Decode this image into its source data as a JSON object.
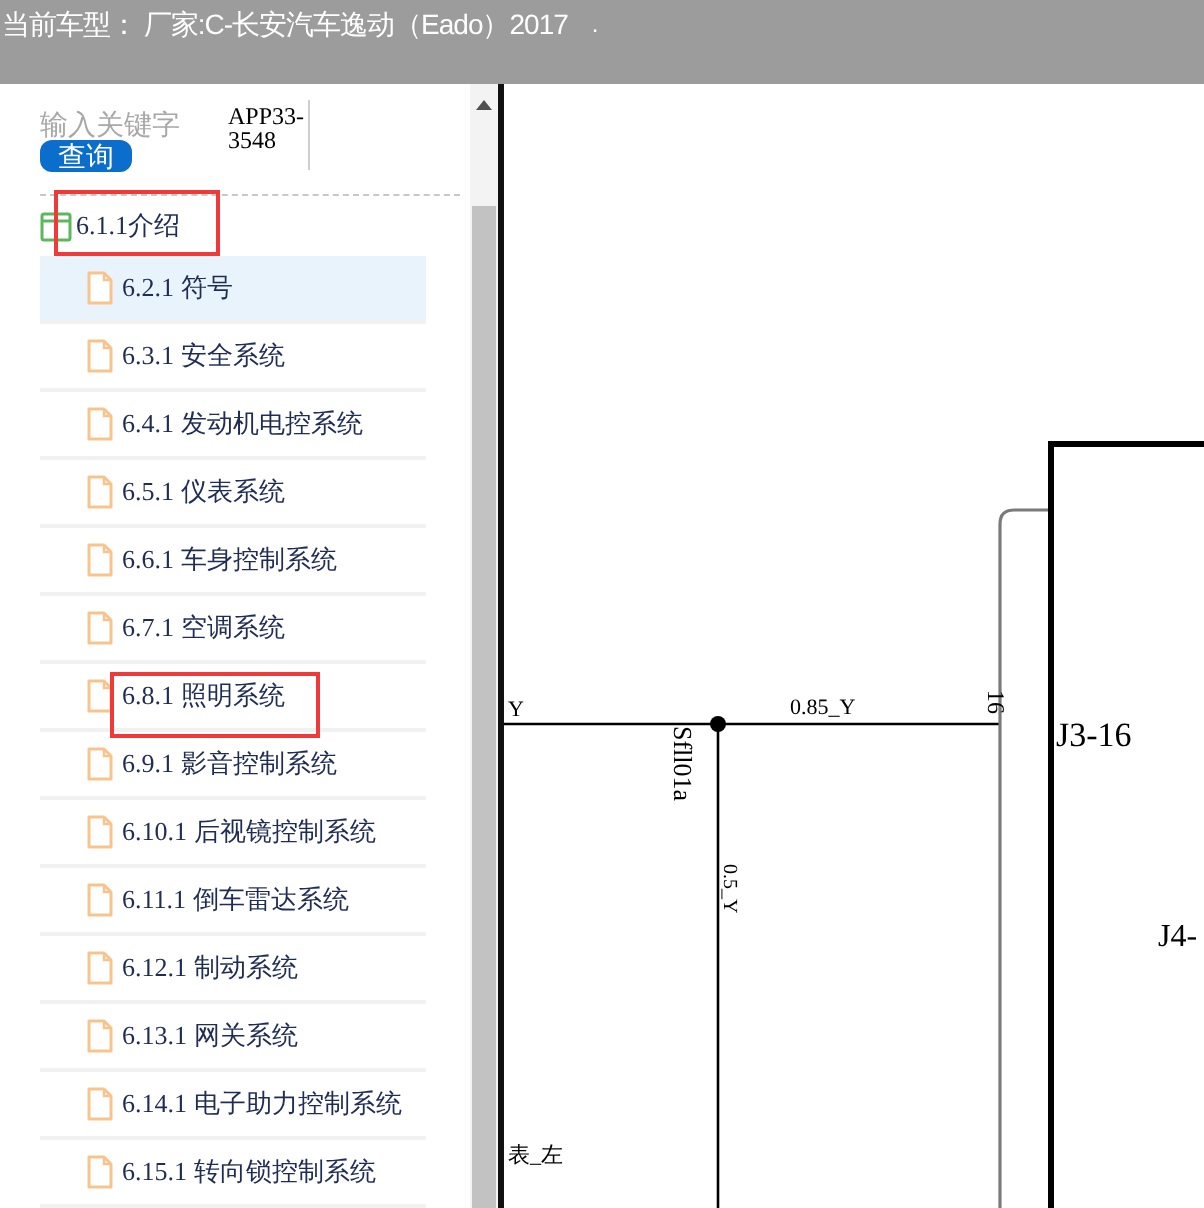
{
  "header": {
    "title": "当前车型： 厂家:C-长安汽车逸动（Eado）2017",
    "suffix": "."
  },
  "search": {
    "placeholder": "输入关键字",
    "button": "查询",
    "code": "APP33-3548"
  },
  "tree": {
    "label": "6.1.1介绍",
    "highlighted": true,
    "children": [
      {
        "label": "6.2.1 符号",
        "selected": true,
        "highlighted": false
      },
      {
        "label": "6.3.1 安全系统",
        "selected": false,
        "highlighted": false
      },
      {
        "label": "6.4.1 发动机电控系统",
        "selected": false,
        "highlighted": false
      },
      {
        "label": "6.5.1 仪表系统",
        "selected": false,
        "highlighted": false
      },
      {
        "label": "6.6.1 车身控制系统",
        "selected": false,
        "highlighted": false
      },
      {
        "label": "6.7.1 空调系统",
        "selected": false,
        "highlighted": false
      },
      {
        "label": "6.8.1 照明系统",
        "selected": false,
        "highlighted": true
      },
      {
        "label": "6.9.1 影音控制系统",
        "selected": false,
        "highlighted": false
      },
      {
        "label": "6.10.1 后视镜控制系统",
        "selected": false,
        "highlighted": false
      },
      {
        "label": "6.11.1 倒车雷达系统",
        "selected": false,
        "highlighted": false
      },
      {
        "label": "6.12.1 制动系统",
        "selected": false,
        "highlighted": false
      },
      {
        "label": "6.13.1 网关系统",
        "selected": false,
        "highlighted": false
      },
      {
        "label": "6.14.1 电子助力控制系统",
        "selected": false,
        "highlighted": false
      },
      {
        "label": "6.15.1 转向锁控制系统",
        "selected": false,
        "highlighted": false
      }
    ]
  },
  "diagram": {
    "wire_left_label": "Y",
    "wire_top_label": "0.85_Y",
    "splice_label": "Sfll01a",
    "wire_down_label": "0.5_Y",
    "pin_label": "16",
    "connector_label": "J3-16",
    "connector_2_label": "J4-",
    "edge_label": "表_左"
  }
}
